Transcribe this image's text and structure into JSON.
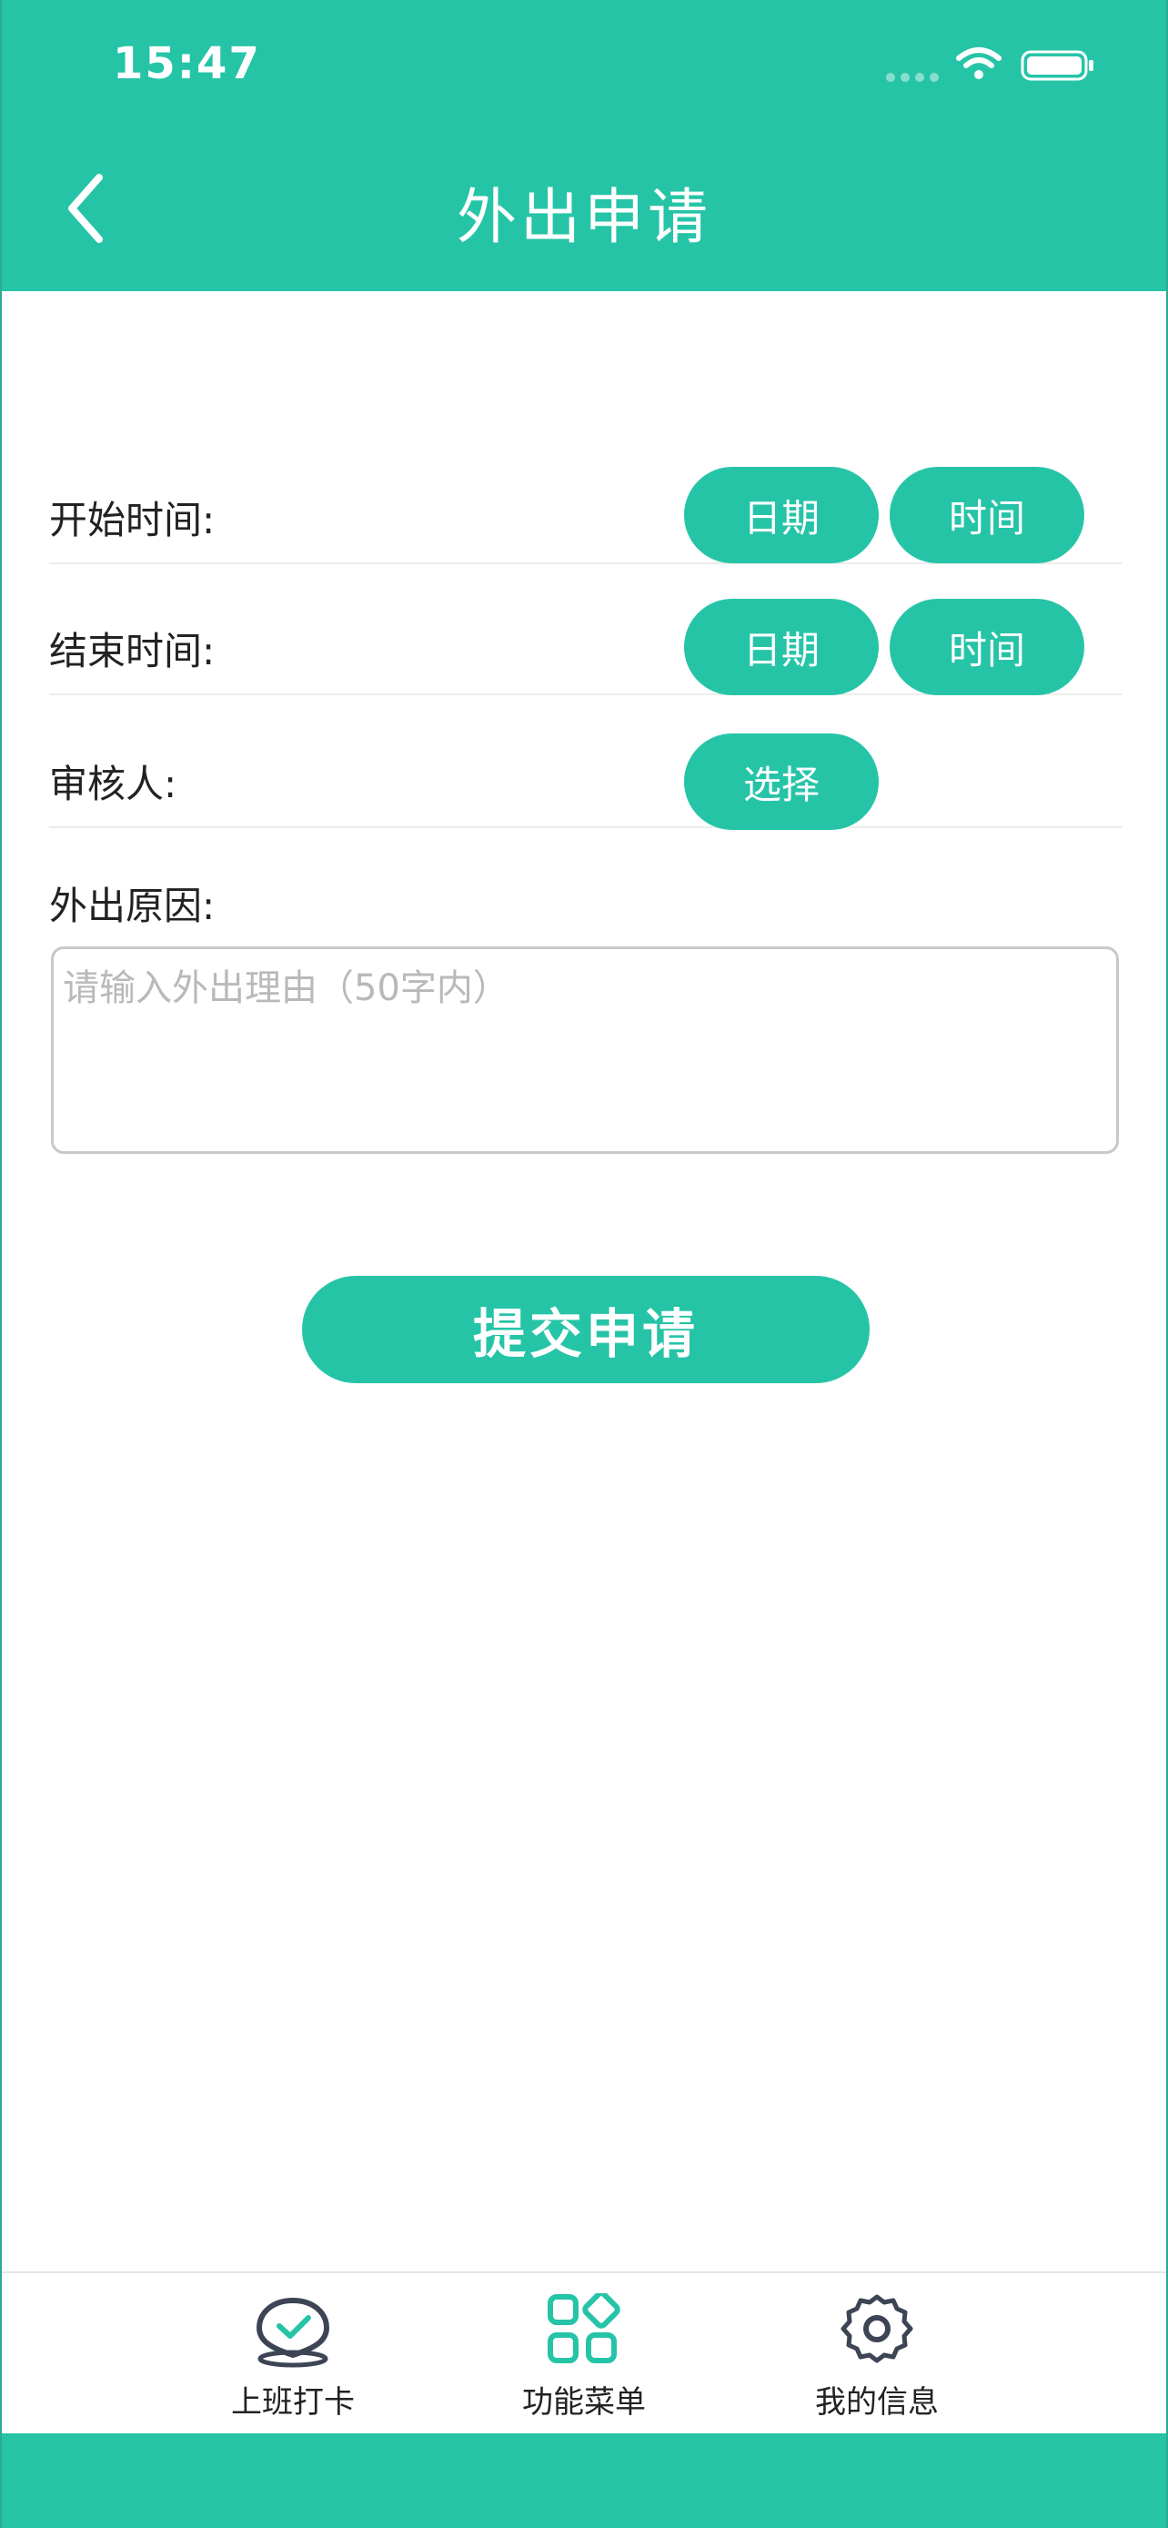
{
  "status_bar": {
    "time": "15:47"
  },
  "header": {
    "title": "外出申请",
    "back_icon": "chevron-left-icon"
  },
  "colors": {
    "accent": "#26c4a7",
    "text": "#222222",
    "placeholder": "#b9b9b9"
  },
  "form": {
    "start_time": {
      "label": "开始时间:",
      "date_button": "日期",
      "time_button": "时间"
    },
    "end_time": {
      "label": "结束时间:",
      "date_button": "日期",
      "time_button": "时间"
    },
    "reviewer": {
      "label": "审核人:",
      "select_button": "选择"
    },
    "reason": {
      "label": "外出原因:",
      "placeholder": "请输入外出理由（50字内）",
      "value": ""
    },
    "submit_label": "提交申请"
  },
  "tabbar": {
    "items": [
      {
        "label": "上班打卡",
        "icon": "check-in-pin-icon"
      },
      {
        "label": "功能菜单",
        "icon": "app-grid-icon"
      },
      {
        "label": "我的信息",
        "icon": "gear-icon"
      }
    ]
  }
}
